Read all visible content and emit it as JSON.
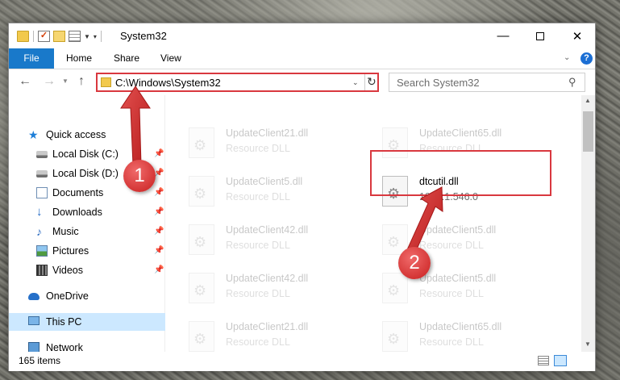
{
  "window": {
    "title": "System32",
    "caption": {
      "minimize": "—",
      "close": "✕"
    }
  },
  "ribbon": {
    "tabs": [
      "File",
      "Home",
      "Share",
      "View"
    ],
    "help": "?"
  },
  "navbar": {
    "address": "C:\\Windows\\System32",
    "search_placeholder": "Search System32"
  },
  "sidebar": {
    "items": [
      {
        "label": "Quick access",
        "icon": "star-icon"
      },
      {
        "label": "Local Disk (C:)",
        "icon": "drive-icon",
        "pinned": true
      },
      {
        "label": "Local Disk (D:)",
        "icon": "drive-icon",
        "pinned": true
      },
      {
        "label": "Documents",
        "icon": "documents-icon",
        "pinned": true
      },
      {
        "label": "Downloads",
        "icon": "downloads-icon",
        "pinned": true
      },
      {
        "label": "Music",
        "icon": "music-icon",
        "pinned": true
      },
      {
        "label": "Pictures",
        "icon": "pictures-icon",
        "pinned": true
      },
      {
        "label": "Videos",
        "icon": "videos-icon",
        "pinned": true
      },
      {
        "label": "OneDrive",
        "icon": "onedrive-icon"
      },
      {
        "label": "This PC",
        "icon": "this-pc-icon",
        "selected": true
      },
      {
        "label": "Network",
        "icon": "network-icon"
      }
    ]
  },
  "files": [
    {
      "name": "UpdateClient21.dll",
      "desc": "Resource DLL",
      "faded": true
    },
    {
      "name": "UpdateClient65.dll",
      "desc": "Resource DLL",
      "faded": true
    },
    {
      "name": "UpdateClient5.dll",
      "desc": "Resource DLL",
      "faded": true
    },
    {
      "name": "dtcutil.dll",
      "desc": "1998.1.546.0",
      "faded": false
    },
    {
      "name": "UpdateClient42.dll",
      "desc": "Resource DLL",
      "faded": true
    },
    {
      "name": "UpdateClient5.dll",
      "desc": "Resource DLL",
      "faded": true
    },
    {
      "name": "UpdateClient42.dll",
      "desc": "Resource DLL",
      "faded": true
    },
    {
      "name": "UpdateClient5.dll",
      "desc": "Resource DLL",
      "faded": true
    },
    {
      "name": "UpdateClient21.dll",
      "desc": "Resource DLL",
      "faded": true
    },
    {
      "name": "UpdateClient65.dll",
      "desc": "Resource DLL",
      "faded": true
    }
  ],
  "status": {
    "items": "165 items"
  },
  "annotations": {
    "step1": "1",
    "step2": "2",
    "color": "#d9383f"
  }
}
